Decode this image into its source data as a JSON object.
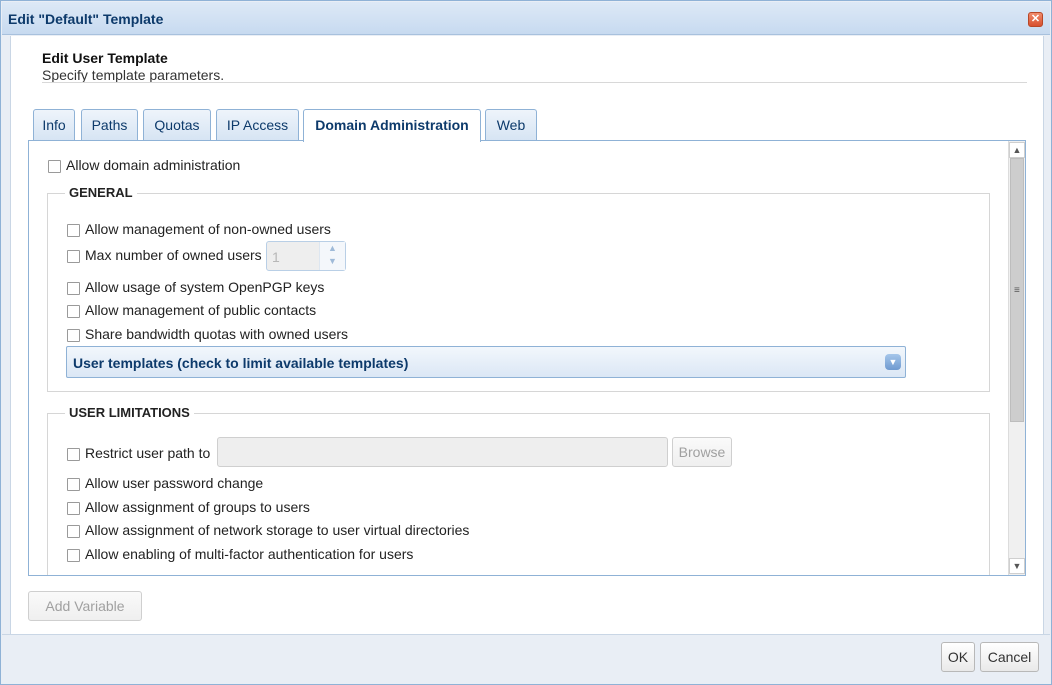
{
  "window": {
    "title": "Edit \"Default\" Template",
    "close_glyph": "✕"
  },
  "header": {
    "title": "Edit User Template",
    "subtitle": "Specify template parameters."
  },
  "tabs": [
    {
      "label": "Info",
      "active": false
    },
    {
      "label": "Paths",
      "active": false
    },
    {
      "label": "Quotas",
      "active": false
    },
    {
      "label": "IP Access",
      "active": false
    },
    {
      "label": "Domain Administration",
      "active": true
    },
    {
      "label": "Web",
      "active": false
    }
  ],
  "panel": {
    "allow_domain_admin": {
      "label": "Allow domain administration",
      "checked": false
    },
    "general": {
      "legend": "GENERAL",
      "non_owned_users": {
        "label": "Allow management of non-owned users",
        "checked": false
      },
      "max_owned_users": {
        "label": "Max number of owned users",
        "checked": false,
        "value": "1"
      },
      "openpgp_keys": {
        "label": "Allow usage of system OpenPGP keys",
        "checked": false
      },
      "public_contacts": {
        "label": "Allow management of public contacts",
        "checked": false
      },
      "share_bandwidth": {
        "label": "Share bandwidth quotas with owned users",
        "checked": false
      },
      "user_templates": {
        "label": "User templates (check to limit available templates)"
      }
    },
    "user_limitations": {
      "legend": "USER LIMITATIONS",
      "restrict_path": {
        "label": "Restrict user path to",
        "checked": false,
        "value": "",
        "browse_label": "Browse"
      },
      "password_change": {
        "label": "Allow user password change",
        "checked": false
      },
      "groups": {
        "label": "Allow assignment of groups to users",
        "checked": false
      },
      "network_storage": {
        "label": "Allow assignment of network storage to user virtual directories",
        "checked": false
      },
      "mfa": {
        "label": "Allow enabling of multi-factor authentication for users",
        "checked": false
      }
    }
  },
  "add_variable_label": "Add Variable",
  "footer": {
    "ok_label": "OK",
    "cancel_label": "Cancel"
  },
  "colors": {
    "accent": "#0d3a6b",
    "border": "#8fb2d6",
    "close": "#d8502f"
  }
}
